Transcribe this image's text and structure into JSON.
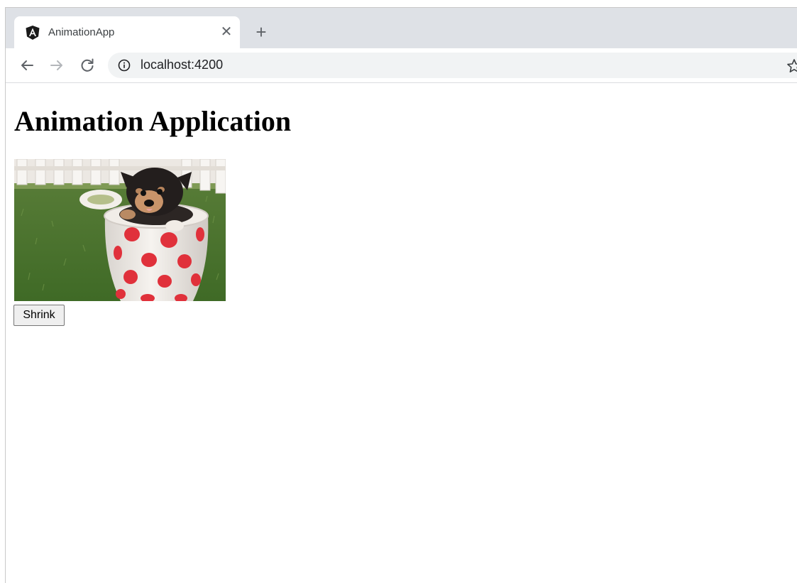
{
  "browser": {
    "tab": {
      "title": "AnimationApp",
      "favicon": "angular-icon",
      "close_glyph": "✕"
    },
    "new_tab_glyph": "+",
    "toolbar": {
      "back": "back-arrow-icon",
      "forward": "forward-arrow-icon",
      "reload": "reload-icon",
      "site_info": "info-icon",
      "bookmark": "star-icon"
    },
    "address_bar": {
      "url": "localhost:4200"
    }
  },
  "page": {
    "heading": "Animation Application",
    "image": {
      "subject": "puppy in red polka-dot cup on grass"
    },
    "button_label": "Shrink"
  },
  "colors": {
    "tabstrip": "#dee1e6",
    "omnibox": "#f1f3f4",
    "icon": "#5f6368",
    "angular_badge": "#1a1a1a"
  }
}
